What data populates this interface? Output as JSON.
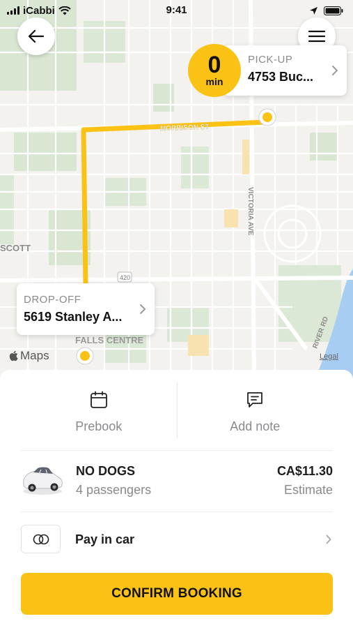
{
  "status_bar": {
    "carrier": "iCabbi",
    "time": "9:41"
  },
  "map": {
    "street_labels": [
      "MORRISON ST",
      "VICTORIA AVE",
      "RIVER RD",
      "SCOTT",
      "FALLS CENTRE",
      "420"
    ],
    "attribution": "Maps",
    "legal": "Legal",
    "route_color": "#fbc216"
  },
  "pickup": {
    "eta_value": "0",
    "eta_unit": "min",
    "label": "PICK-UP",
    "address": "4753 Buc..."
  },
  "dropoff": {
    "label": "DROP-OFF",
    "address": "5619 Stanley A..."
  },
  "actions": {
    "prebook_label": "Prebook",
    "add_note_label": "Add note"
  },
  "ride": {
    "name": "NO DOGS",
    "passengers": "4 passengers",
    "price": "CA$11.30",
    "price_note": "Estimate"
  },
  "payment": {
    "label": "Pay in car"
  },
  "confirm": {
    "label": "CONFIRM BOOKING"
  },
  "colors": {
    "accent": "#fbc216",
    "muted_text": "#8a8a8e"
  }
}
